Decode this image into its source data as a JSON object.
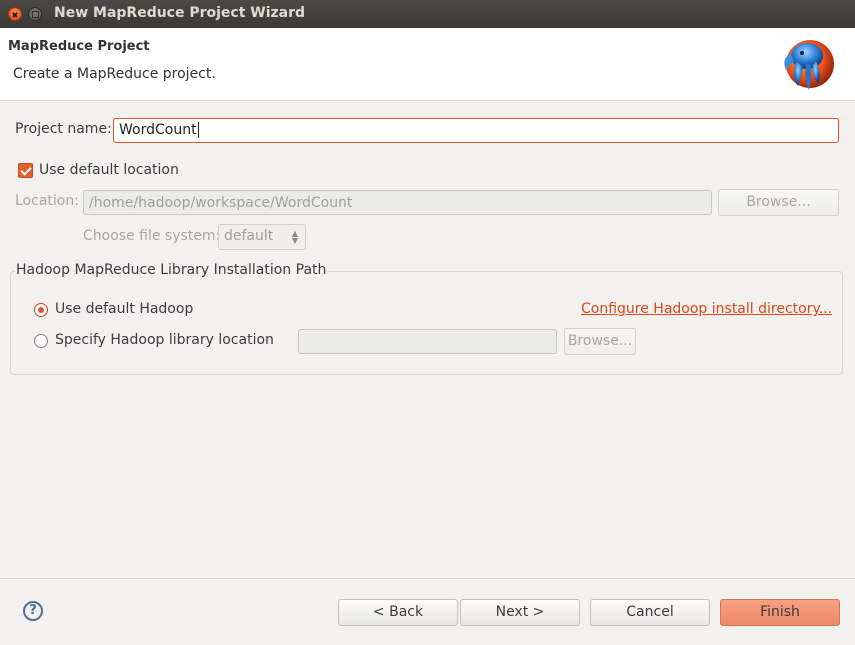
{
  "window": {
    "title": "New MapReduce Project Wizard"
  },
  "header": {
    "title": "MapReduce Project",
    "description": "Create a MapReduce project.",
    "logo_icon": "hadoop-elephant-icon"
  },
  "project": {
    "name_label": "Project name:",
    "name_value": "WordCount"
  },
  "location": {
    "use_default_label": "Use default location",
    "use_default_checked": true,
    "location_label": "Location:",
    "location_value": "/home/hadoop/workspace/WordCount",
    "browse_label": "Browse...",
    "fs_label": "Choose file system:",
    "fs_value": "default"
  },
  "hadoop": {
    "group_title": "Hadoop MapReduce Library Installation Path",
    "use_default_label": "Use default Hadoop",
    "configure_link": "Configure Hadoop install directory...",
    "specify_label": "Specify Hadoop library location",
    "specify_value": "",
    "browse_label": "Browse..."
  },
  "footer": {
    "back_label": "< Back",
    "next_label": "Next >",
    "cancel_label": "Cancel",
    "finish_label": "Finish",
    "help_icon": "help-icon"
  },
  "colors": {
    "accent": "#e2542a",
    "link": "#dd4814",
    "finish": "#ee8a68"
  }
}
